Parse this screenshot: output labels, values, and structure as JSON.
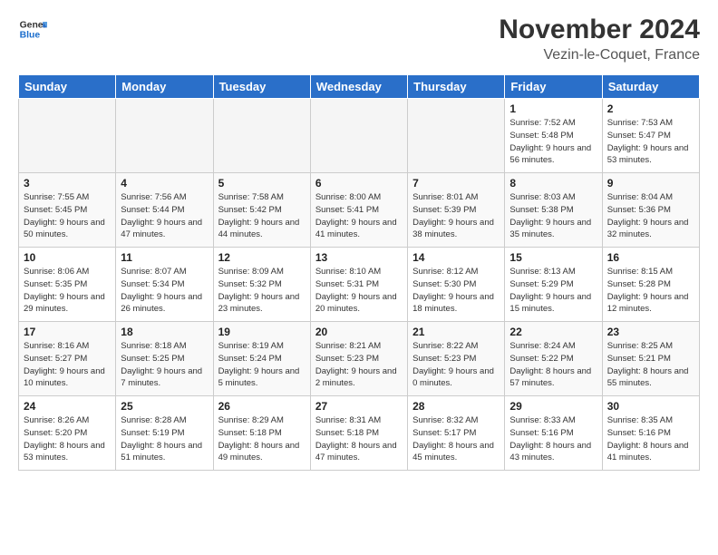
{
  "logo": {
    "line1": "General",
    "line2": "Blue"
  },
  "title": "November 2024",
  "subtitle": "Vezin-le-Coquet, France",
  "days_of_week": [
    "Sunday",
    "Monday",
    "Tuesday",
    "Wednesday",
    "Thursday",
    "Friday",
    "Saturday"
  ],
  "weeks": [
    [
      {
        "day": "",
        "info": ""
      },
      {
        "day": "",
        "info": ""
      },
      {
        "day": "",
        "info": ""
      },
      {
        "day": "",
        "info": ""
      },
      {
        "day": "",
        "info": ""
      },
      {
        "day": "1",
        "info": "Sunrise: 7:52 AM\nSunset: 5:48 PM\nDaylight: 9 hours and 56 minutes."
      },
      {
        "day": "2",
        "info": "Sunrise: 7:53 AM\nSunset: 5:47 PM\nDaylight: 9 hours and 53 minutes."
      }
    ],
    [
      {
        "day": "3",
        "info": "Sunrise: 7:55 AM\nSunset: 5:45 PM\nDaylight: 9 hours and 50 minutes."
      },
      {
        "day": "4",
        "info": "Sunrise: 7:56 AM\nSunset: 5:44 PM\nDaylight: 9 hours and 47 minutes."
      },
      {
        "day": "5",
        "info": "Sunrise: 7:58 AM\nSunset: 5:42 PM\nDaylight: 9 hours and 44 minutes."
      },
      {
        "day": "6",
        "info": "Sunrise: 8:00 AM\nSunset: 5:41 PM\nDaylight: 9 hours and 41 minutes."
      },
      {
        "day": "7",
        "info": "Sunrise: 8:01 AM\nSunset: 5:39 PM\nDaylight: 9 hours and 38 minutes."
      },
      {
        "day": "8",
        "info": "Sunrise: 8:03 AM\nSunset: 5:38 PM\nDaylight: 9 hours and 35 minutes."
      },
      {
        "day": "9",
        "info": "Sunrise: 8:04 AM\nSunset: 5:36 PM\nDaylight: 9 hours and 32 minutes."
      }
    ],
    [
      {
        "day": "10",
        "info": "Sunrise: 8:06 AM\nSunset: 5:35 PM\nDaylight: 9 hours and 29 minutes."
      },
      {
        "day": "11",
        "info": "Sunrise: 8:07 AM\nSunset: 5:34 PM\nDaylight: 9 hours and 26 minutes."
      },
      {
        "day": "12",
        "info": "Sunrise: 8:09 AM\nSunset: 5:32 PM\nDaylight: 9 hours and 23 minutes."
      },
      {
        "day": "13",
        "info": "Sunrise: 8:10 AM\nSunset: 5:31 PM\nDaylight: 9 hours and 20 minutes."
      },
      {
        "day": "14",
        "info": "Sunrise: 8:12 AM\nSunset: 5:30 PM\nDaylight: 9 hours and 18 minutes."
      },
      {
        "day": "15",
        "info": "Sunrise: 8:13 AM\nSunset: 5:29 PM\nDaylight: 9 hours and 15 minutes."
      },
      {
        "day": "16",
        "info": "Sunrise: 8:15 AM\nSunset: 5:28 PM\nDaylight: 9 hours and 12 minutes."
      }
    ],
    [
      {
        "day": "17",
        "info": "Sunrise: 8:16 AM\nSunset: 5:27 PM\nDaylight: 9 hours and 10 minutes."
      },
      {
        "day": "18",
        "info": "Sunrise: 8:18 AM\nSunset: 5:25 PM\nDaylight: 9 hours and 7 minutes."
      },
      {
        "day": "19",
        "info": "Sunrise: 8:19 AM\nSunset: 5:24 PM\nDaylight: 9 hours and 5 minutes."
      },
      {
        "day": "20",
        "info": "Sunrise: 8:21 AM\nSunset: 5:23 PM\nDaylight: 9 hours and 2 minutes."
      },
      {
        "day": "21",
        "info": "Sunrise: 8:22 AM\nSunset: 5:23 PM\nDaylight: 9 hours and 0 minutes."
      },
      {
        "day": "22",
        "info": "Sunrise: 8:24 AM\nSunset: 5:22 PM\nDaylight: 8 hours and 57 minutes."
      },
      {
        "day": "23",
        "info": "Sunrise: 8:25 AM\nSunset: 5:21 PM\nDaylight: 8 hours and 55 minutes."
      }
    ],
    [
      {
        "day": "24",
        "info": "Sunrise: 8:26 AM\nSunset: 5:20 PM\nDaylight: 8 hours and 53 minutes."
      },
      {
        "day": "25",
        "info": "Sunrise: 8:28 AM\nSunset: 5:19 PM\nDaylight: 8 hours and 51 minutes."
      },
      {
        "day": "26",
        "info": "Sunrise: 8:29 AM\nSunset: 5:18 PM\nDaylight: 8 hours and 49 minutes."
      },
      {
        "day": "27",
        "info": "Sunrise: 8:31 AM\nSunset: 5:18 PM\nDaylight: 8 hours and 47 minutes."
      },
      {
        "day": "28",
        "info": "Sunrise: 8:32 AM\nSunset: 5:17 PM\nDaylight: 8 hours and 45 minutes."
      },
      {
        "day": "29",
        "info": "Sunrise: 8:33 AM\nSunset: 5:16 PM\nDaylight: 8 hours and 43 minutes."
      },
      {
        "day": "30",
        "info": "Sunrise: 8:35 AM\nSunset: 5:16 PM\nDaylight: 8 hours and 41 minutes."
      }
    ]
  ]
}
